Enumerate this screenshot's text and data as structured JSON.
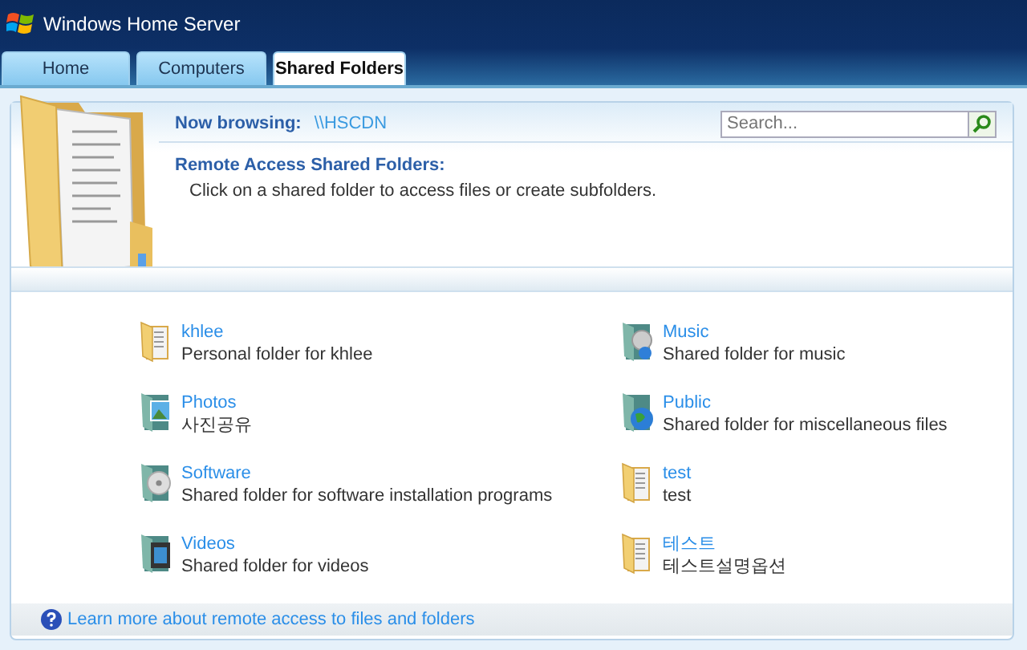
{
  "window": {
    "title": "Windows Home Server"
  },
  "tabs": [
    {
      "label": "Home",
      "selected": false
    },
    {
      "label": "Computers",
      "selected": false
    },
    {
      "label": "Shared Folders",
      "selected": true
    }
  ],
  "browsing": {
    "label": "Now browsing:",
    "path": "\\\\HSCDN"
  },
  "search": {
    "placeholder": "Search..."
  },
  "heading": "Remote Access Shared Folders:",
  "subheading": "Click on a shared folder to access files or create subfolders.",
  "folders": [
    {
      "name": "khlee",
      "description": "Personal folder for khlee",
      "kind": "plain"
    },
    {
      "name": "Music",
      "description": "Shared folder for music",
      "kind": "music"
    },
    {
      "name": "Photos",
      "description": "사진공유",
      "kind": "photos"
    },
    {
      "name": "Public",
      "description": "Shared folder for miscellaneous files",
      "kind": "public"
    },
    {
      "name": "Software",
      "description": "Shared folder for software installation programs",
      "kind": "software"
    },
    {
      "name": "test",
      "description": "test",
      "kind": "plain"
    },
    {
      "name": "Videos",
      "description": "Shared folder for videos",
      "kind": "videos"
    },
    {
      "name": "테스트",
      "description": "테스트설명옵션",
      "kind": "plain"
    }
  ],
  "help_link": "Learn more about remote access to files and folders"
}
